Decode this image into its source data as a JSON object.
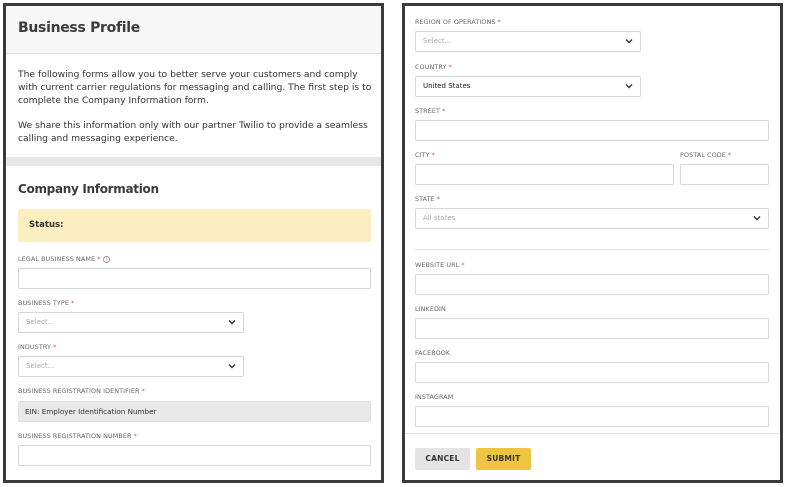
{
  "left": {
    "title": "Business Profile",
    "intro_p1": "The following forms allow you to better serve your customers and comply with current carrier regulations for messaging and calling. The first step is to complete the Company Information form.",
    "intro_p2": "We share this information only with our partner Twilio to provide a seamless calling and messaging experience.",
    "section_title": "Company Information",
    "status_label": "Status:",
    "legal_name_label": "LEGAL BUSINESS NAME",
    "business_type_label": "BUSINESS TYPE",
    "business_type_placeholder": "Select...",
    "industry_label": "INDUSTRY",
    "industry_placeholder": "Select...",
    "reg_identifier_label": "BUSINESS REGISTRATION IDENTIFIER",
    "reg_identifier_value": "EIN: Employer Identification Number",
    "reg_number_label": "BUSINESS REGISTRATION NUMBER"
  },
  "right": {
    "region_label": "REGION OF OPERATIONS",
    "region_placeholder": "Select...",
    "country_label": "COUNTRY",
    "country_value": "United States",
    "street_label": "STREET",
    "city_label": "CITY",
    "postal_label": "POSTAL CODE",
    "state_label": "STATE",
    "state_placeholder": "All states",
    "website_label": "WEBSITE URL",
    "linkedin_label": "LINKEDIN",
    "facebook_label": "FACEBOOK",
    "instagram_label": "INSTAGRAM",
    "cancel_label": "CANCEL",
    "submit_label": "SUBMIT"
  },
  "symbols": {
    "required": "*",
    "info": "i"
  },
  "colors": {
    "status_bg": "#fbefc1",
    "submit_bg": "#efc53f",
    "required": "#d9534f"
  }
}
